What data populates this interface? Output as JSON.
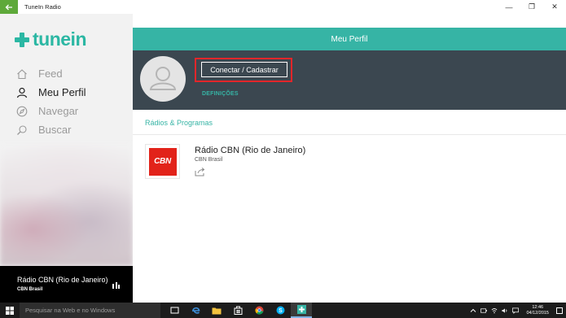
{
  "window": {
    "title": "TuneIn Radio",
    "controls": [
      "—",
      "❐",
      "✕"
    ]
  },
  "sidebar": {
    "logo_text": "tunein",
    "items": [
      {
        "label": "Feed",
        "icon": "home-icon",
        "active": false
      },
      {
        "label": "Meu Perfil",
        "icon": "user-icon",
        "active": true
      },
      {
        "label": "Navegar",
        "icon": "compass-icon",
        "active": false
      },
      {
        "label": "Buscar",
        "icon": "search-icon",
        "active": false
      }
    ]
  },
  "now_playing": {
    "title": "Rádio CBN (Rio de Janeiro)",
    "subtitle": "CBN Brasil"
  },
  "main": {
    "header_title": "Meu Perfil",
    "connect_label": "Conectar / Cadastrar",
    "settings_label": "DEFINIÇÕES",
    "section_title": "Rádios & Programas",
    "stations": [
      {
        "name": "Rádio CBN (Rio de Janeiro)",
        "subtitle": "CBN Brasil",
        "logo_text": "CBN"
      }
    ]
  },
  "taskbar": {
    "search_placeholder": "Pesquisar na Web e no Windows",
    "apps": [
      "task-view-icon",
      "edge-icon",
      "file-explorer-icon",
      "store-icon",
      "chrome-icon",
      "skype-icon",
      "tunein-app-icon"
    ],
    "time": "12:46",
    "date": "04/12/2015"
  },
  "colors": {
    "accent": "#36b4a5",
    "profile_band": "#3b4750",
    "highlight": "#e3262a",
    "cbn_red": "#e2231a",
    "titlebar_back": "#5ea93a"
  }
}
